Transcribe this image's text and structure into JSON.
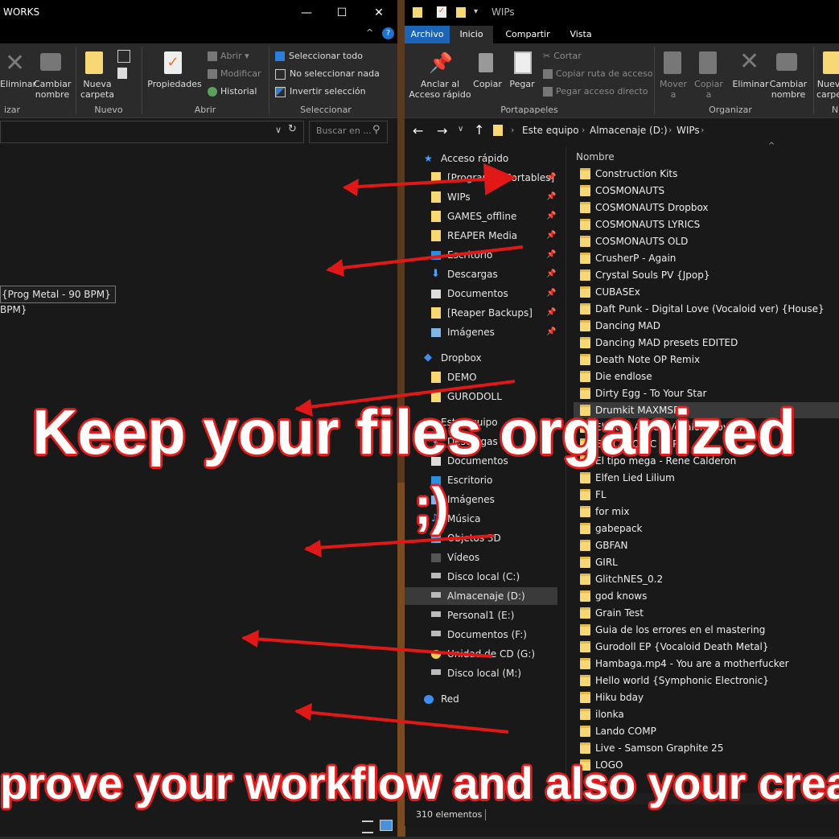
{
  "left_window": {
    "title": "WORKS",
    "ribbon": {
      "buttons": {
        "eliminar": "Eliminar",
        "cambiar_nombre": "Cambiar nombre",
        "nueva_carpeta": "Nueva carpeta",
        "propiedades": "Propiedades"
      },
      "small": {
        "abrir": "Abrir",
        "modificar": "Modificar",
        "historial": "Historial",
        "seleccionar_todo": "Seleccionar todo",
        "no_seleccionar_nada": "No seleccionar nada",
        "invertir_seleccion": "Invertir selección"
      },
      "groups": {
        "organizar": "izar",
        "nuevo": "Nuevo",
        "abrir": "Abrir",
        "seleccionar": "Seleccionar"
      }
    },
    "search_placeholder": "Buscar en ...",
    "content_lines": [
      "{Prog Metal - 90 BPM}",
      "BPM}"
    ]
  },
  "right_window": {
    "title": "WIPs",
    "tabs": [
      "Archivo",
      "Inicio",
      "Compartir",
      "Vista"
    ],
    "ribbon": {
      "buttons": {
        "anclar": "Anclar al Acceso rápido",
        "copiar": "Copiar",
        "pegar": "Pegar",
        "mover": "Mover a",
        "copiar_a": "Copiar a",
        "eliminar": "Eliminar",
        "cambiar_nombre": "Cambiar nombre",
        "nueva": "Nuev carpe"
      },
      "small": {
        "cortar": "Cortar",
        "copiar_ruta": "Copiar ruta de acceso",
        "pegar_acceso": "Pegar acceso directo"
      },
      "groups": {
        "portapapeles": "Portapapeles",
        "organizar": "Organizar",
        "n": "N"
      }
    },
    "breadcrumb": [
      "Este equipo",
      "Almacenaje (D:)",
      "WIPs"
    ],
    "column_header": "Nombre",
    "nav": [
      {
        "label": "Acceso rápido",
        "type": "star",
        "level": 0
      },
      {
        "label": "[Programas Portables]",
        "type": "folder",
        "level": 1,
        "pin": true
      },
      {
        "label": "WIPs",
        "type": "folder",
        "level": 1,
        "pin": true
      },
      {
        "label": "GAMES_offline",
        "type": "folder",
        "level": 1,
        "pin": true
      },
      {
        "label": "REAPER Media",
        "type": "folder",
        "level": 1,
        "pin": true
      },
      {
        "label": "Escritorio",
        "type": "desktop",
        "level": 1,
        "pin": true
      },
      {
        "label": "Descargas",
        "type": "download",
        "level": 1,
        "pin": true
      },
      {
        "label": "Documentos",
        "type": "doc",
        "level": 1,
        "pin": true
      },
      {
        "label": "[Reaper Backups]",
        "type": "folder",
        "level": 1,
        "pin": true
      },
      {
        "label": "Imágenes",
        "type": "image",
        "level": 1,
        "pin": true
      },
      {
        "label": "Dropbox",
        "type": "dropbox",
        "level": 0
      },
      {
        "label": "DEMO",
        "type": "folder",
        "level": 1
      },
      {
        "label": "GURODOLL",
        "type": "folder",
        "level": 1
      },
      {
        "label": "Este equipo",
        "type": "pc",
        "level": 0
      },
      {
        "label": "Descargas",
        "type": "download",
        "level": 1
      },
      {
        "label": "Documentos",
        "type": "doc",
        "level": 1
      },
      {
        "label": "Escritorio",
        "type": "desktop",
        "level": 1
      },
      {
        "label": "Imágenes",
        "type": "image",
        "level": 1
      },
      {
        "label": "Música",
        "type": "music",
        "level": 1
      },
      {
        "label": "Objetos 3D",
        "type": "cube",
        "level": 1
      },
      {
        "label": "Vídeos",
        "type": "video",
        "level": 1
      },
      {
        "label": "Disco local (C:)",
        "type": "drive",
        "level": 1
      },
      {
        "label": "Almacenaje (D:)",
        "type": "drive",
        "level": 1,
        "selected": true
      },
      {
        "label": "Personal1 (E:)",
        "type": "drive",
        "level": 1
      },
      {
        "label": "Documentos (F:)",
        "type": "drive",
        "level": 1
      },
      {
        "label": "Unidad de CD (G:)",
        "type": "cd",
        "level": 1
      },
      {
        "label": "Disco local (M:)",
        "type": "drive",
        "level": 1
      },
      {
        "label": "Red",
        "type": "network",
        "level": 0
      }
    ],
    "files": [
      "Construction Kits",
      "COSMONAUTS",
      "COSMONAUTS Dropbox",
      "COSMONAUTS LYRICS",
      "COSMONAUTS OLD",
      "CrusherP - Again",
      "Crystal Souls PV {Jpop}",
      "CUBASEx",
      "Daft Punk - Digital Love (Vocaloid ver) {House}",
      "Dancing MAD",
      "Dancing MAD presets EDITED",
      "Death Note OP Remix",
      "Die endlose",
      "Dirty Egg - To Your Star",
      "Drumkit MAXMSP",
      "Electric Angel (Vocaloid cover)",
      "ELECTRONIC RAP",
      "El tipo mega - Rene Calderon",
      "Elfen Lied Lilium",
      "FL",
      "for mix",
      "gabepack",
      "GBFAN",
      "GIRL",
      "GlitchNES_0.2",
      "god knows",
      "Grain Test",
      "Guia de los errores en el mastering",
      "Gurodoll EP {Vocaloid Death Metal}",
      "Hambaga.mp4 - You are a motherfucker",
      "Hello world {Symphonic Electronic}",
      "Hiku bday",
      "ilonka",
      "Lando COMP",
      "Live - Samson Graphite 25",
      "LOGO"
    ],
    "selected_file": "Drumkit MAXMSP",
    "status": "310 elementos"
  },
  "overlay": {
    "headline": "Keep your files organized",
    "wink": ";)",
    "bottom": "prove your workflow and also your creat"
  },
  "colors": {
    "arrow": "#e01818",
    "folder": "#f8d775",
    "accent": "#0063b1"
  }
}
